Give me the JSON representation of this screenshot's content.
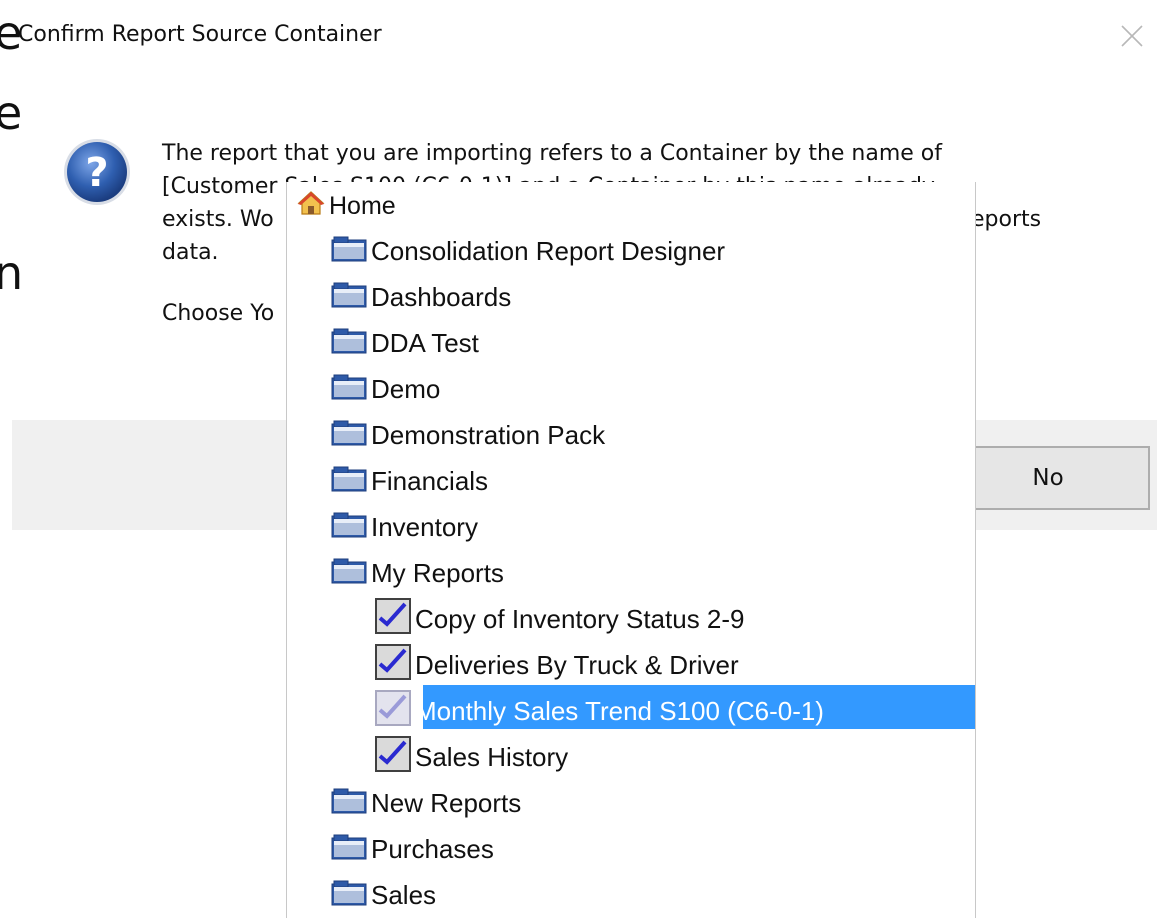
{
  "background_fragments": [
    "e",
    "e",
    "n"
  ],
  "dialog": {
    "title": "Confirm Report Source Container",
    "close_icon": "close-icon",
    "question_icon": "question-icon",
    "message_lines": [
      "The report that you are importing refers to a Container by the name of",
      "[Customer Sales S100 (C6-0-1)] and a Container by this name already",
      "exists. Wo",
      "data."
    ],
    "message_line3_tail": "eports",
    "choose_text": "Choose Yo",
    "no_button_label": "No"
  },
  "tree": {
    "root": {
      "label": "Home",
      "icon": "home-icon"
    },
    "items": [
      {
        "label": "Consolidation Report Designer",
        "type": "folder",
        "level": 1
      },
      {
        "label": "Dashboards",
        "type": "folder",
        "level": 1
      },
      {
        "label": "DDA Test",
        "type": "folder",
        "level": 1
      },
      {
        "label": "Demo",
        "type": "folder",
        "level": 1
      },
      {
        "label": "Demonstration Pack",
        "type": "folder",
        "level": 1
      },
      {
        "label": "Financials",
        "type": "folder",
        "level": 1
      },
      {
        "label": "Inventory",
        "type": "folder",
        "level": 1
      },
      {
        "label": "My Reports",
        "type": "folder",
        "level": 1
      },
      {
        "label": "Copy of Inventory Status 2-9",
        "type": "report",
        "level": 2
      },
      {
        "label": "Deliveries By Truck & Driver",
        "type": "report",
        "level": 2
      },
      {
        "label": "Monthly Sales Trend S100 (C6-0-1)",
        "type": "report",
        "level": 2,
        "selected": true
      },
      {
        "label": "Sales History",
        "type": "report",
        "level": 2
      },
      {
        "label": "New Reports",
        "type": "folder",
        "level": 1
      },
      {
        "label": "Purchases",
        "type": "folder",
        "level": 1
      },
      {
        "label": "Sales",
        "type": "folder",
        "level": 1
      }
    ]
  },
  "colors": {
    "selection": "#3399ff",
    "button_bar": "#f0f0f0",
    "icon_blue": "#2f5fb0"
  }
}
